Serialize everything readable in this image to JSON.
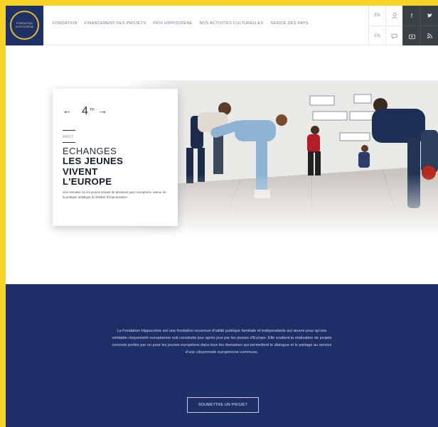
{
  "brand": {
    "logo_lines": [
      "FONDATION",
      "HIPPOCRÈNE"
    ]
  },
  "nav": {
    "items": [
      "FONDATION",
      "FINANCEMENT DES PROJETS",
      "PRIX HIPPOCRÈNE",
      "NOS ACTIVITÉS CULTURELLES",
      "SERICE DES PAYS"
    ]
  },
  "utility": {
    "lang_top": "EN",
    "lang_bottom": "EN"
  },
  "hero": {
    "number": "4",
    "number_sup": "TH",
    "prev_arrow": "←",
    "next_arrow": "→",
    "category": "MAST",
    "title_light": "ECHANGES",
    "title_bold": "LES JEUNES VIVENT L'EUROPE",
    "description": "Une semaine où les jeunes venant de plusieurs pays européens, autour de la pratique artistique du théâtre d'improvisation"
  },
  "footer": {
    "intro": "La Fondation Hippocrène est une fondation reconnue d'utilité publique familiale et indépendante qui œuvre pour qu'une véritable citoyenneté européenne soit construite jour après jour par les jeunes d'Europe. Elle soutient la réalisation de projets concrets portés par ou pour les jeunes européens dans tous les domaines qui permettent le dialogue et le partage au service d'une citoyenneté européenne commune.",
    "cta_label": "SOUMETTRE UN PROJET"
  },
  "colors": {
    "accent_yellow": "#f5d327",
    "navy": "#1e2f68",
    "logo_gold": "#e6b82a"
  }
}
